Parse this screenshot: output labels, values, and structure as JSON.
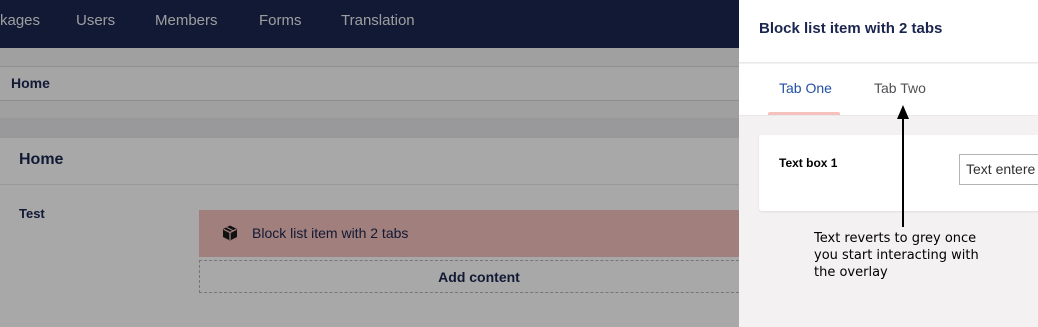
{
  "topnav": {
    "items": [
      "kages",
      "Users",
      "Members",
      "Forms",
      "Translation"
    ]
  },
  "breadcrumb": "Home",
  "panel": {
    "title": "Home",
    "property_label": "Test",
    "block_item": {
      "label": "Block list item with 2 tabs",
      "icon": "cube-icon"
    },
    "add_content_label": "Add content"
  },
  "editor": {
    "title": "Block list item with 2 tabs",
    "tabs": [
      "Tab One",
      "Tab Two"
    ],
    "active_tab": "Tab One",
    "field": {
      "label": "Text box 1",
      "value": "Text entere"
    }
  },
  "annotation": {
    "lines": [
      "Text reverts to grey once",
      "you start interacting with",
      "the overlay"
    ]
  },
  "colors": {
    "nav_bg": "#1b264f",
    "active_tab": "#2152a3",
    "block_bg": "#f5c1bc",
    "tab_indicator": "#f5c1bc"
  }
}
